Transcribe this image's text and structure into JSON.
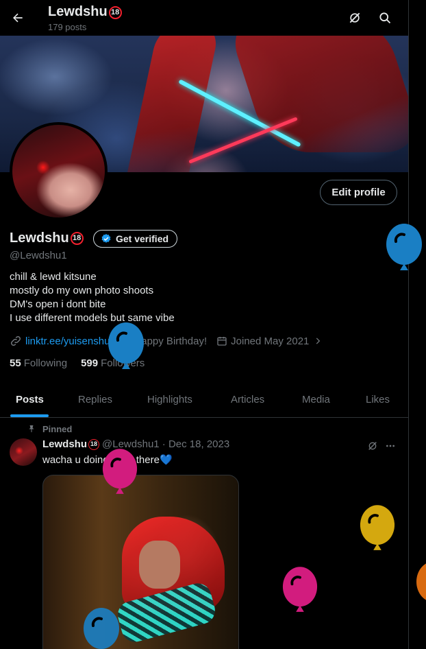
{
  "header": {
    "title": "Lewdshu",
    "title_badge": "18",
    "posts_count": "179 posts"
  },
  "profile": {
    "edit_label": "Edit profile",
    "name": "Lewdshu",
    "name_badge": "18",
    "get_verified_label": "Get verified",
    "handle": "@Lewdshu1",
    "bio": [
      "chill & lewd kitsune",
      "mostly do my own photo shoots",
      "DM's open i dont bite",
      "I use different models but same vibe"
    ],
    "link": "linktr.ee/yuisenshu",
    "birthday": "Happy Birthday!",
    "joined": "Joined May 2021",
    "following_count": "55",
    "following_label": "Following",
    "followers_count": "599",
    "followers_label": "Followers"
  },
  "tabs": [
    "Posts",
    "Replies",
    "Highlights",
    "Articles",
    "Media",
    "Likes"
  ],
  "active_tab": "Posts",
  "tweet": {
    "pinned_label": "Pinned",
    "name": "Lewdshu",
    "name_badge": "18",
    "handle_date": "@Lewdshu1 · Dec 18, 2023",
    "text": "wacha u doing back there💙"
  },
  "colors": {
    "accent": "#1d9bf0",
    "balloon_blue": "#1a7fc4",
    "balloon_pink": "#d21c7e",
    "balloon_gold": "#d4a80f",
    "balloon_orange": "#d86a10"
  },
  "icons": [
    "back-arrow-icon",
    "grok-icon",
    "search-icon",
    "verified-badge-icon",
    "link-icon",
    "birthday-balloon-icon",
    "calendar-icon",
    "chevron-right-icon",
    "pin-icon",
    "more-icon",
    "balloon-icon"
  ]
}
